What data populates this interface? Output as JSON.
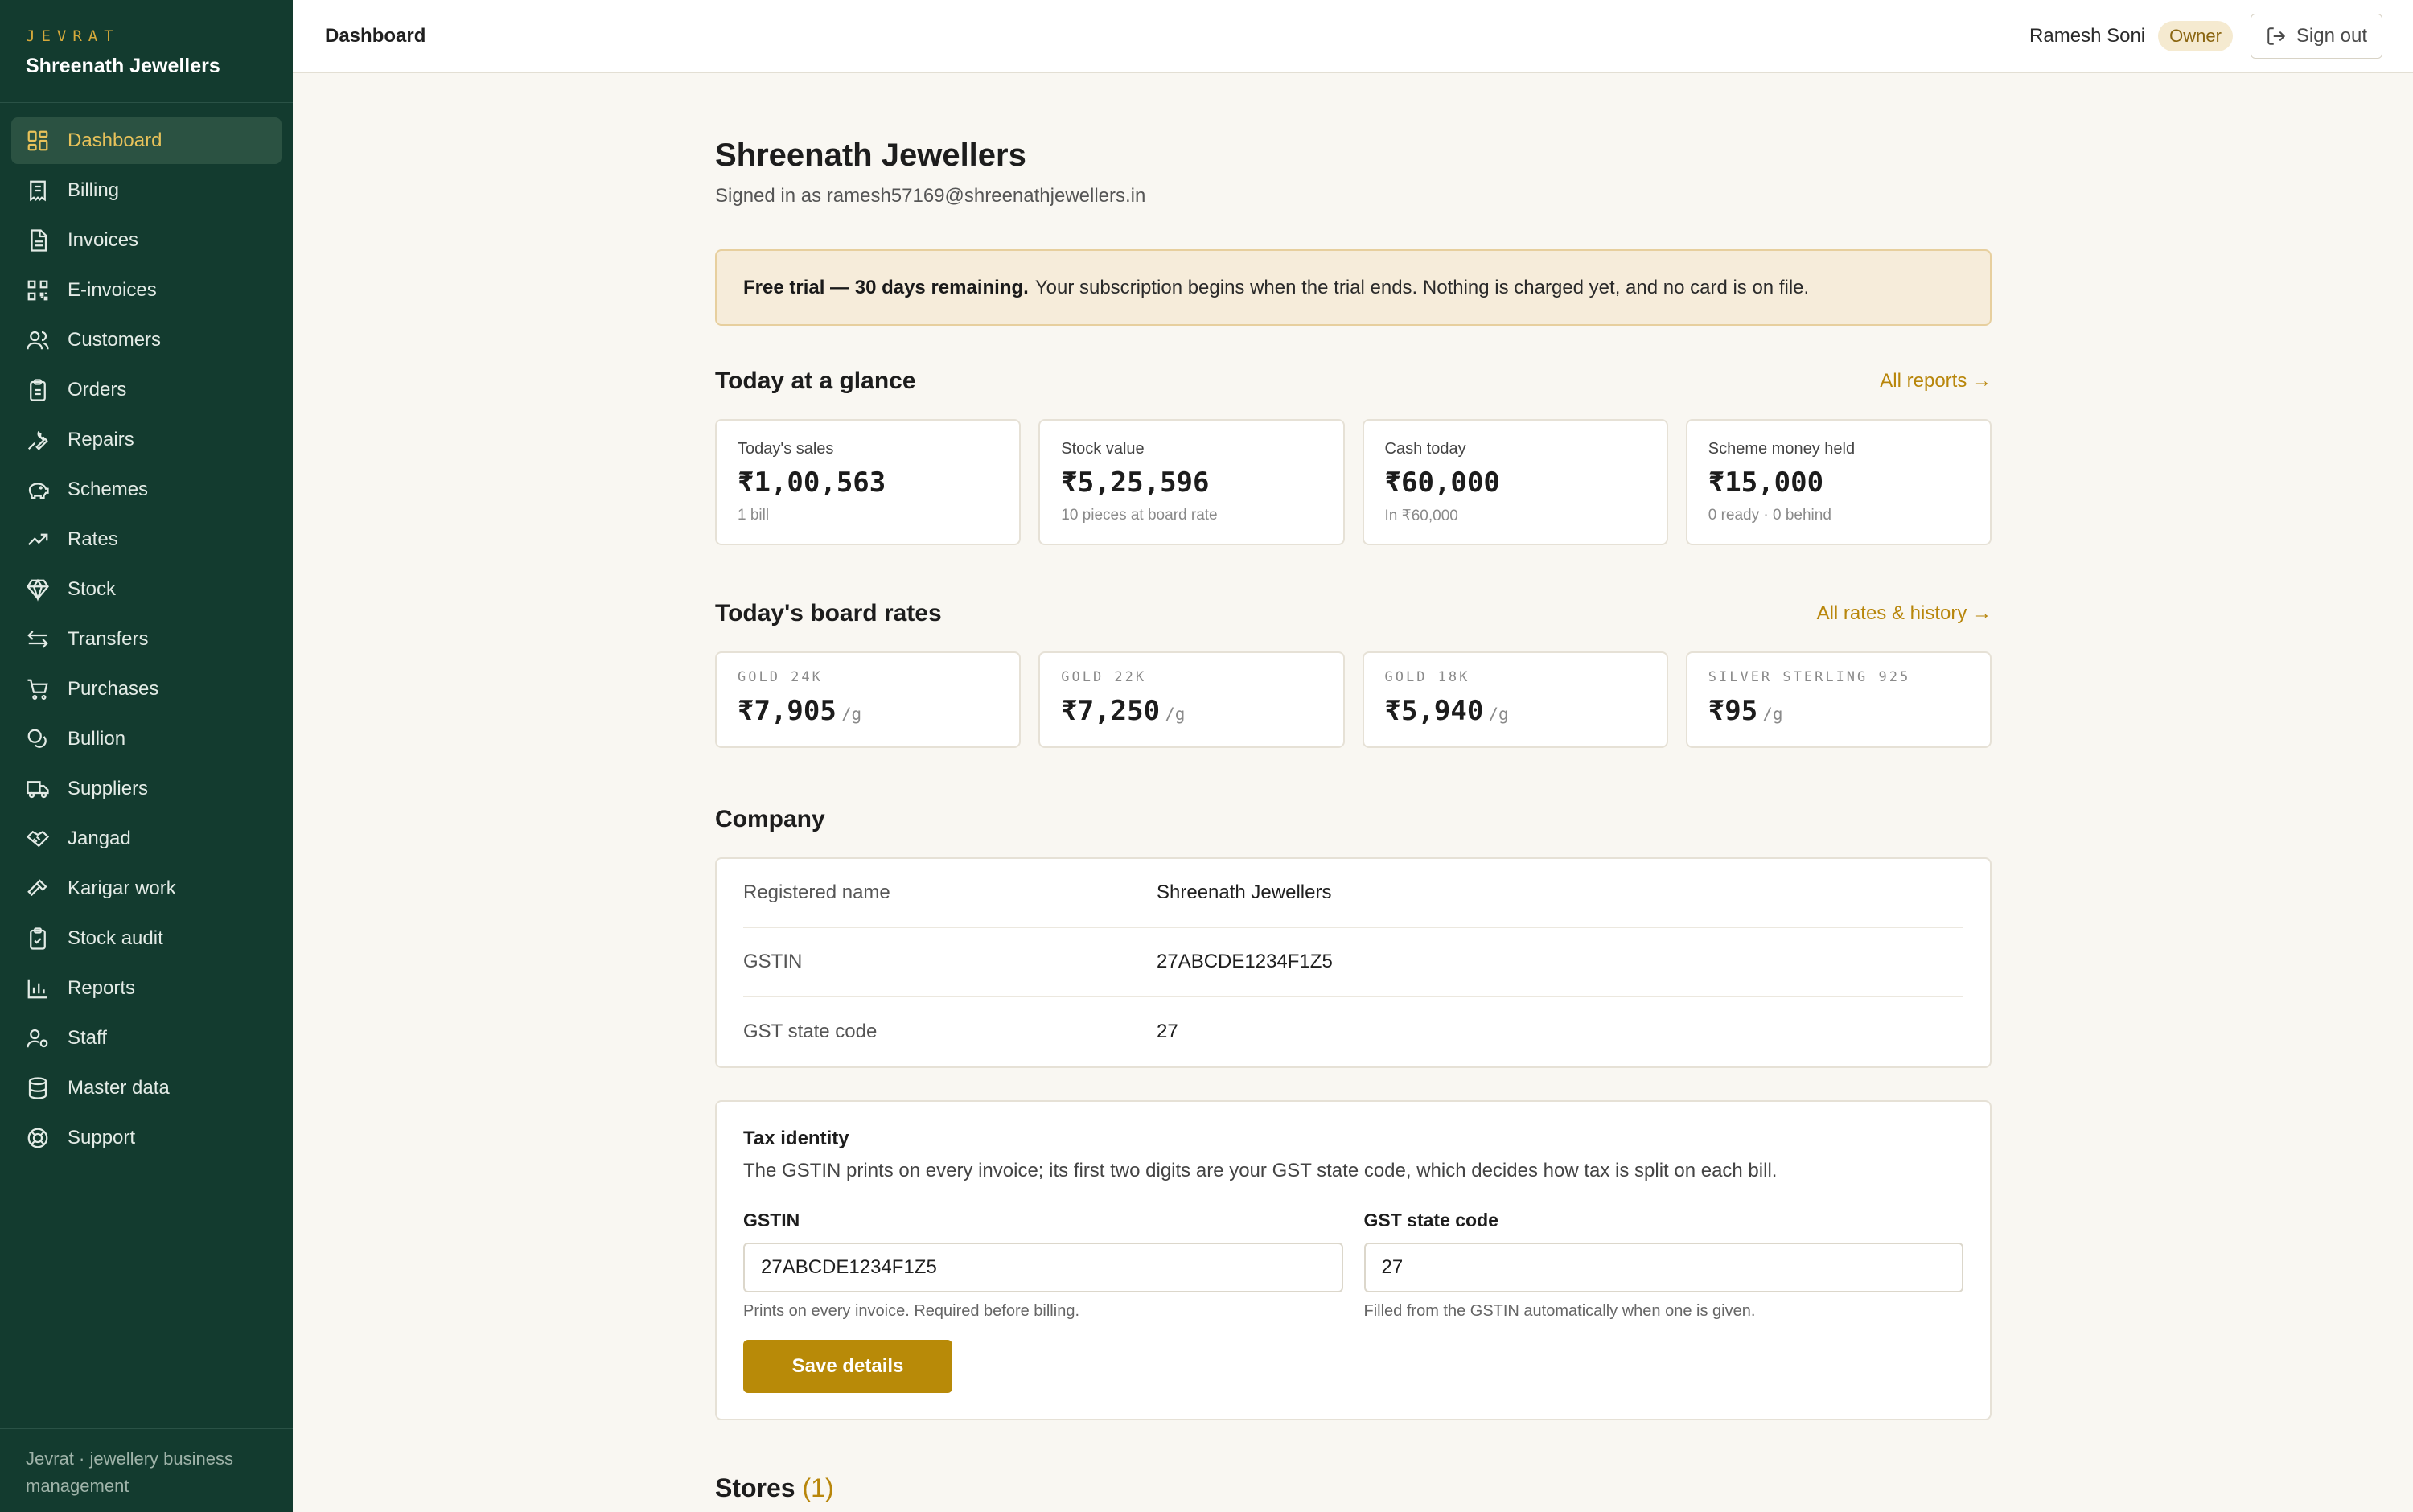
{
  "brand": {
    "kicker": "JEVRAT",
    "name": "Shreenath Jewellers"
  },
  "sidebar": {
    "items": [
      {
        "label": "Dashboard",
        "icon": "dashboard-icon",
        "active": true
      },
      {
        "label": "Billing",
        "icon": "receipt-icon"
      },
      {
        "label": "Invoices",
        "icon": "invoice-icon"
      },
      {
        "label": "E-invoices",
        "icon": "qr-icon"
      },
      {
        "label": "Customers",
        "icon": "users-icon"
      },
      {
        "label": "Orders",
        "icon": "clipboard-icon"
      },
      {
        "label": "Repairs",
        "icon": "wrench-icon"
      },
      {
        "label": "Schemes",
        "icon": "piggy-bank-icon"
      },
      {
        "label": "Rates",
        "icon": "trending-up-icon"
      },
      {
        "label": "Stock",
        "icon": "gem-icon"
      },
      {
        "label": "Transfers",
        "icon": "transfer-icon"
      },
      {
        "label": "Purchases",
        "icon": "cart-icon"
      },
      {
        "label": "Bullion",
        "icon": "coins-icon"
      },
      {
        "label": "Suppliers",
        "icon": "truck-icon"
      },
      {
        "label": "Jangad",
        "icon": "handshake-icon"
      },
      {
        "label": "Karigar work",
        "icon": "hammer-icon"
      },
      {
        "label": "Stock audit",
        "icon": "clipboard-check-icon"
      },
      {
        "label": "Reports",
        "icon": "bar-chart-icon"
      },
      {
        "label": "Staff",
        "icon": "user-cog-icon"
      },
      {
        "label": "Master data",
        "icon": "database-icon"
      },
      {
        "label": "Support",
        "icon": "lifebuoy-icon"
      }
    ],
    "footer": "Jevrat · jewellery business management"
  },
  "topbar": {
    "title": "Dashboard",
    "user": "Ramesh Soni",
    "role": "Owner",
    "signout_label": "Sign out"
  },
  "page": {
    "title": "Shreenath Jewellers",
    "subtitle": "Signed in as ramesh57169@shreenathjewellers.in"
  },
  "trial": {
    "bold": "Free trial — 30 days remaining.",
    "text": "Your subscription begins when the trial ends. Nothing is charged yet, and no card is on file."
  },
  "glance": {
    "title": "Today at a glance",
    "link": "All reports →",
    "cards": [
      {
        "label": "Today's sales",
        "value": "₹1,00,563",
        "sub": "1 bill"
      },
      {
        "label": "Stock value",
        "value": "₹5,25,596",
        "sub": "10 pieces at board rate"
      },
      {
        "label": "Cash today",
        "value": "₹60,000",
        "sub": "In ₹60,000"
      },
      {
        "label": "Scheme money held",
        "value": "₹15,000",
        "sub": "0 ready · 0 behind"
      }
    ]
  },
  "rates": {
    "title": "Today's board rates",
    "link": "All rates & history →",
    "items": [
      {
        "label": "GOLD 24K",
        "value": "₹7,905",
        "unit": "/g"
      },
      {
        "label": "GOLD 22K",
        "value": "₹7,250",
        "unit": "/g"
      },
      {
        "label": "GOLD 18K",
        "value": "₹5,940",
        "unit": "/g"
      },
      {
        "label": "SILVER STERLING 925",
        "value": "₹95",
        "unit": "/g"
      }
    ]
  },
  "company": {
    "title": "Company",
    "rows": [
      {
        "key": "Registered name",
        "value": "Shreenath Jewellers"
      },
      {
        "key": "GSTIN",
        "value": "27ABCDE1234F1Z5"
      },
      {
        "key": "GST state code",
        "value": "27"
      }
    ]
  },
  "tax": {
    "title": "Tax identity",
    "description": "The GSTIN prints on every invoice; its first two digits are your GST state code, which decides how tax is split on each bill.",
    "gstin_label": "GSTIN",
    "gstin_value": "27ABCDE1234F1Z5",
    "gstin_help": "Prints on every invoice. Required before billing.",
    "state_label": "GST state code",
    "state_value": "27",
    "state_help": "Filled from the GSTIN automatically when one is given.",
    "save_label": "Save details"
  },
  "stores": {
    "title": "Stores",
    "count": "(1)"
  },
  "colors": {
    "sidebar": "#133b2f",
    "accent": "#b88a08",
    "active_text": "#e8c25a"
  }
}
